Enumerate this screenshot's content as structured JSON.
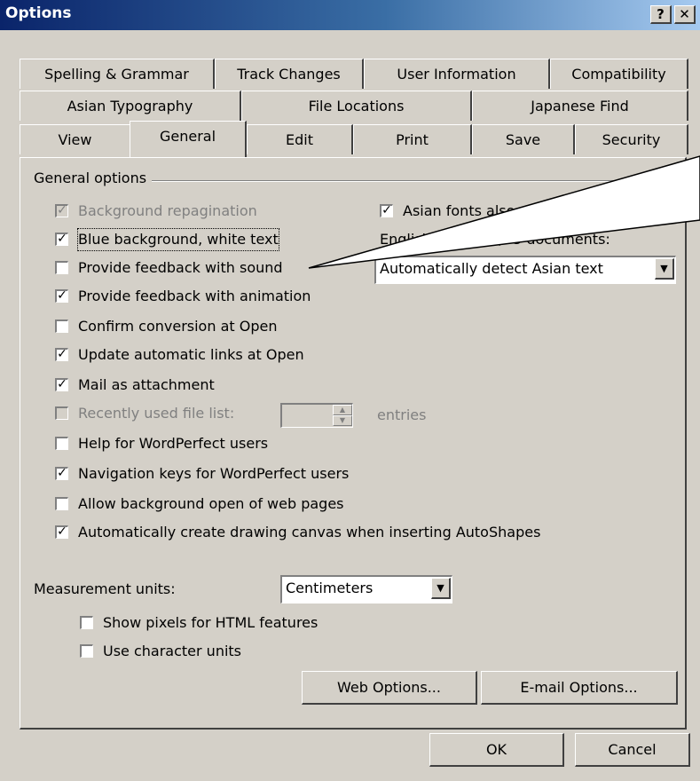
{
  "window": {
    "title": "Options",
    "help_button": "?",
    "close_button": "✕"
  },
  "tabs": {
    "row1": [
      "Spelling & Grammar",
      "Track Changes",
      "User Information",
      "Compatibility"
    ],
    "row2": [
      "Asian Typography",
      "File Locations",
      "Japanese Find"
    ],
    "row3": [
      "View",
      "General",
      "Edit",
      "Print",
      "Save",
      "Security"
    ],
    "selected": "General"
  },
  "general": {
    "group_label": "General options",
    "options": [
      {
        "label": "Background repagination",
        "checked": true,
        "enabled": false
      },
      {
        "label": "Blue background, white text",
        "checked": true,
        "enabled": true
      },
      {
        "label": "Provide feedback with sound",
        "checked": false,
        "enabled": true
      },
      {
        "label": "Provide feedback with animation",
        "checked": true,
        "enabled": true
      },
      {
        "label": "Confirm conversion at Open",
        "checked": false,
        "enabled": true
      },
      {
        "label": "Update automatic links at Open",
        "checked": true,
        "enabled": true
      },
      {
        "label": "Mail as attachment",
        "checked": true,
        "enabled": true
      },
      {
        "label": "Recently used file list:",
        "checked": false,
        "enabled": false
      },
      {
        "label": "Help for WordPerfect users",
        "checked": false,
        "enabled": true
      },
      {
        "label": "Navigation keys for WordPerfect users",
        "checked": true,
        "enabled": true
      },
      {
        "label": "Allow background open of web pages",
        "checked": false,
        "enabled": true
      },
      {
        "label": "Automatically create drawing canvas when inserting AutoShapes",
        "checked": true,
        "enabled": true
      }
    ],
    "recent_files_suffix": "entries",
    "recent_files_count": "",
    "asian_fonts": {
      "label": "Asian fonts also app",
      "checked": true
    },
    "english_word_label": "English Word 6.0/95 documents:",
    "english_word_value": "Automatically detect Asian text",
    "measurement_label": "Measurement units:",
    "measurement_value": "Centimeters",
    "show_pixels": {
      "label": "Show pixels for HTML features",
      "checked": false
    },
    "char_units": {
      "label": "Use character units",
      "checked": false
    },
    "web_options_button": "Web Options...",
    "email_options_button": "E-mail Options..."
  },
  "footer": {
    "ok_button": "OK",
    "cancel_button": "Cancel"
  },
  "colors": {
    "title_start": "#0a246a",
    "title_end": "#a6caf0",
    "face": "#d4d0c8"
  }
}
